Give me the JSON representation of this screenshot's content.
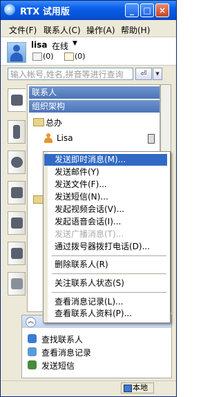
{
  "window": {
    "title": "RTX 试用版",
    "controls": {
      "minimize": "_",
      "maximize": "□",
      "close": "×"
    }
  },
  "menubar": [
    {
      "label": "文件(F)"
    },
    {
      "label": "联系人(C)"
    },
    {
      "label": "操作(A)"
    },
    {
      "label": "帮助(H)"
    }
  ],
  "user": {
    "name": "lisa",
    "status": "在线",
    "status_arrow": "▼",
    "mail_count": "(0)",
    "notice_count": "(0)"
  },
  "search": {
    "placeholder": "输入帐号,姓名,拼音等进行查询",
    "go_glyph": "⏎",
    "drop_glyph": "▾"
  },
  "side_tabs": [
    {
      "icon": "contacts-icon",
      "active": true
    },
    {
      "icon": "mobile-icon"
    },
    {
      "icon": "headset-icon"
    },
    {
      "icon": "phone-book-icon"
    },
    {
      "icon": "group-icon"
    },
    {
      "icon": "multi-user-icon"
    },
    {
      "icon": "notepad-icon"
    }
  ],
  "contacts_panel": {
    "groups": [
      {
        "label": "联系人"
      },
      {
        "label": "组织架构"
      }
    ],
    "tree": [
      {
        "type": "folder",
        "label": "总办"
      },
      {
        "type": "person",
        "label": "Lisa",
        "has_phone": true
      }
    ]
  },
  "context_menu": [
    {
      "label": "发送即时消息(M)...",
      "highlighted": true
    },
    {
      "label": "发送邮件(Y)"
    },
    {
      "label": "发送文件(F)..."
    },
    {
      "label": "发送短信(N)..."
    },
    {
      "label": "发起视频会话(V)..."
    },
    {
      "label": "发起语音会话(I)..."
    },
    {
      "label": "发送广播消息(T)...",
      "disabled": true
    },
    {
      "label": "通过拨号器拨打电话(D)...",
      "sep_after": true
    },
    {
      "label": "删除联系人(R)",
      "sep_after": true
    },
    {
      "label": "关注联系人状态(S)",
      "sep_after": true
    },
    {
      "label": "查看消息记录(L)..."
    },
    {
      "label": "查看联系人资料(P)..."
    }
  ],
  "bottom_panel": {
    "collapse_glyph": "︽",
    "items": [
      {
        "label": "查找联系人",
        "icon": "find-contact-icon",
        "color": "#3a7bd5"
      },
      {
        "label": "查看消息记录",
        "icon": "message-log-icon",
        "color": "#5a9ad8"
      },
      {
        "label": "发送短信",
        "icon": "sms-icon",
        "color": "#4a8a3a"
      }
    ]
  },
  "statusbar": {
    "local_label": "本地"
  }
}
